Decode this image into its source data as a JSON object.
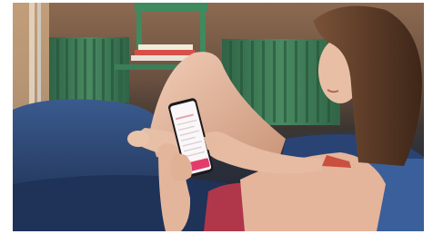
{
  "photo": {
    "subject": "",
    "colors": {
      "wall": "#7a5a44",
      "radiator": "#3f7a55",
      "cushion": "#2f4a78",
      "skin": "#e2b79e",
      "hair": "#5a3a28",
      "top": "#c9503f",
      "shorts": "#b0374a",
      "phone_accent": "#e23d6a"
    }
  },
  "phone_ui": {
    "header": "",
    "rows": [
      "",
      "",
      "",
      "",
      ""
    ],
    "button": ""
  }
}
